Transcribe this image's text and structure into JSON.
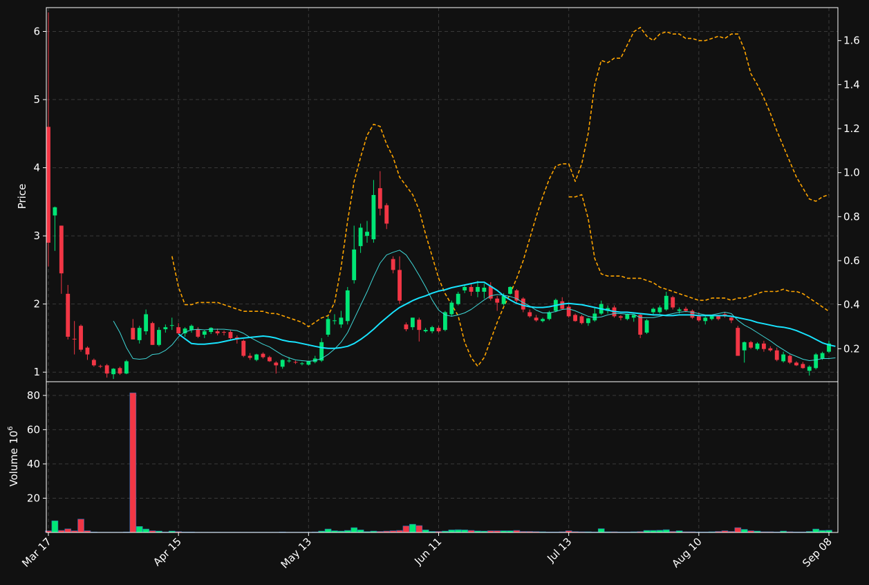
{
  "theme": {
    "background": "#111111",
    "grid": "#3a3a3a",
    "axis": "#ffffff",
    "up_color": "#00e676",
    "down_color": "#f23645",
    "ma_slow_color": "#18e4ff",
    "ma_fast_color": "#3fd8d8",
    "secondary_color": "#ffa500"
  },
  "chart_data": [
    {
      "type": "candlestick",
      "ylabel": "Price",
      "ylim": [
        0.86,
        6.35
      ],
      "yticks": [
        1,
        2,
        3,
        4,
        5,
        6
      ],
      "y2lim": [
        0.05,
        1.75
      ],
      "y2ticks": [
        0.2,
        0.4,
        0.6,
        0.8,
        1.0,
        1.2,
        1.4,
        1.6
      ],
      "grid": true,
      "x_tick_labels": [
        {
          "index": 0,
          "label": "Mar 17"
        },
        {
          "index": 20,
          "label": "Apr 15"
        },
        {
          "index": 40,
          "label": "May 13"
        },
        {
          "index": 60,
          "label": "Jun 11"
        },
        {
          "index": 80,
          "label": "Jul 13"
        },
        {
          "index": 100,
          "label": "Aug 10"
        },
        {
          "index": 120,
          "label": "Sep 08"
        }
      ],
      "ohlc": [
        [
          4.6,
          6.28,
          2.55,
          2.9
        ],
        [
          3.3,
          3.43,
          2.78,
          3.42
        ],
        [
          3.15,
          3.15,
          2.15,
          2.45
        ],
        [
          2.15,
          2.28,
          1.48,
          1.52
        ],
        [
          1.49,
          1.75,
          1.26,
          1.48
        ],
        [
          1.68,
          1.7,
          1.3,
          1.33
        ],
        [
          1.36,
          1.38,
          1.18,
          1.26
        ],
        [
          1.18,
          1.2,
          1.08,
          1.1
        ],
        [
          1.09,
          1.11,
          1.06,
          1.08
        ],
        [
          1.1,
          1.12,
          0.92,
          0.98
        ],
        [
          0.97,
          1.06,
          0.9,
          1.05
        ],
        [
          1.06,
          1.08,
          0.96,
          0.98
        ],
        [
          0.98,
          1.18,
          0.97,
          1.16
        ],
        [
          1.65,
          1.78,
          1.48,
          1.48
        ],
        [
          1.47,
          1.68,
          1.42,
          1.65
        ],
        [
          1.6,
          1.92,
          1.55,
          1.85
        ],
        [
          1.72,
          1.74,
          1.4,
          1.4
        ],
        [
          1.4,
          1.66,
          1.38,
          1.62
        ],
        [
          1.63,
          1.7,
          1.58,
          1.66
        ],
        [
          1.68,
          1.8,
          1.62,
          1.69
        ],
        [
          1.66,
          1.72,
          1.55,
          1.57
        ],
        [
          1.57,
          1.66,
          1.52,
          1.64
        ],
        [
          1.62,
          1.7,
          1.58,
          1.68
        ],
        [
          1.63,
          1.66,
          1.5,
          1.52
        ],
        [
          1.55,
          1.62,
          1.5,
          1.6
        ],
        [
          1.59,
          1.66,
          1.56,
          1.65
        ],
        [
          1.6,
          1.64,
          1.54,
          1.57
        ],
        [
          1.59,
          1.61,
          1.54,
          1.58
        ],
        [
          1.59,
          1.62,
          1.48,
          1.5
        ],
        [
          1.51,
          1.54,
          1.42,
          1.48
        ],
        [
          1.46,
          1.48,
          1.22,
          1.24
        ],
        [
          1.24,
          1.28,
          1.18,
          1.21
        ],
        [
          1.18,
          1.27,
          1.16,
          1.26
        ],
        [
          1.27,
          1.29,
          1.2,
          1.22
        ],
        [
          1.22,
          1.24,
          1.15,
          1.16
        ],
        [
          1.14,
          1.16,
          0.98,
          1.1
        ],
        [
          1.08,
          1.19,
          1.05,
          1.18
        ],
        [
          1.16,
          1.22,
          1.14,
          1.17
        ],
        [
          1.15,
          1.17,
          1.12,
          1.14
        ],
        [
          1.13,
          1.15,
          1.1,
          1.13
        ],
        [
          1.11,
          1.17,
          1.1,
          1.16
        ],
        [
          1.15,
          1.24,
          1.13,
          1.2
        ],
        [
          1.17,
          1.5,
          1.15,
          1.44
        ],
        [
          1.55,
          1.82,
          1.52,
          1.78
        ],
        [
          1.75,
          1.85,
          1.7,
          1.76
        ],
        [
          1.7,
          1.9,
          1.65,
          1.8
        ],
        [
          1.75,
          2.25,
          1.7,
          2.2
        ],
        [
          2.35,
          3.15,
          2.3,
          2.8
        ],
        [
          2.85,
          3.18,
          2.75,
          3.12
        ],
        [
          3.0,
          3.22,
          2.9,
          3.06
        ],
        [
          2.95,
          3.82,
          2.9,
          3.6
        ],
        [
          3.7,
          3.95,
          3.3,
          3.4
        ],
        [
          3.45,
          3.48,
          3.1,
          3.18
        ],
        [
          2.66,
          2.7,
          2.45,
          2.5
        ],
        [
          2.5,
          2.7,
          2.0,
          2.05
        ],
        [
          1.7,
          1.73,
          1.6,
          1.63
        ],
        [
          1.66,
          1.8,
          1.62,
          1.8
        ],
        [
          1.77,
          1.8,
          1.45,
          1.62
        ],
        [
          1.6,
          1.65,
          1.58,
          1.62
        ],
        [
          1.6,
          1.68,
          1.57,
          1.66
        ],
        [
          1.65,
          1.68,
          1.58,
          1.6
        ],
        [
          1.62,
          1.9,
          1.6,
          1.88
        ],
        [
          1.85,
          2.05,
          1.82,
          2.02
        ],
        [
          2.0,
          2.18,
          1.98,
          2.15
        ],
        [
          2.2,
          2.28,
          2.16,
          2.25
        ],
        [
          2.25,
          2.3,
          2.12,
          2.18
        ],
        [
          2.18,
          2.34,
          2.1,
          2.25
        ],
        [
          2.18,
          2.3,
          2.08,
          2.24
        ],
        [
          2.26,
          2.32,
          2.05,
          2.08
        ],
        [
          2.08,
          2.12,
          1.9,
          2.02
        ],
        [
          2.0,
          2.16,
          1.98,
          2.12
        ],
        [
          2.15,
          2.26,
          2.14,
          2.25
        ],
        [
          2.2,
          2.22,
          2.02,
          2.05
        ],
        [
          2.08,
          2.1,
          1.88,
          1.92
        ],
        [
          1.88,
          1.92,
          1.8,
          1.82
        ],
        [
          1.8,
          1.84,
          1.74,
          1.76
        ],
        [
          1.75,
          1.8,
          1.73,
          1.78
        ],
        [
          1.78,
          1.9,
          1.76,
          1.88
        ],
        [
          1.9,
          2.08,
          1.88,
          2.06
        ],
        [
          2.04,
          2.1,
          1.92,
          1.93
        ],
        [
          1.96,
          2.0,
          1.8,
          1.82
        ],
        [
          1.84,
          1.86,
          1.74,
          1.75
        ],
        [
          1.82,
          1.84,
          1.7,
          1.72
        ],
        [
          1.72,
          1.8,
          1.68,
          1.79
        ],
        [
          1.76,
          1.96,
          1.74,
          1.86
        ],
        [
          1.86,
          2.05,
          1.84,
          2.0
        ],
        [
          1.9,
          1.98,
          1.86,
          1.94
        ],
        [
          1.95,
          1.98,
          1.8,
          1.82
        ],
        [
          1.82,
          1.84,
          1.76,
          1.8
        ],
        [
          1.78,
          1.86,
          1.76,
          1.85
        ],
        [
          1.8,
          1.82,
          1.74,
          1.84
        ],
        [
          1.84,
          1.86,
          1.5,
          1.55
        ],
        [
          1.58,
          1.78,
          1.56,
          1.76
        ],
        [
          1.88,
          1.95,
          1.85,
          1.93
        ],
        [
          1.88,
          1.98,
          1.86,
          1.95
        ],
        [
          1.92,
          2.18,
          1.9,
          2.12
        ],
        [
          2.1,
          2.12,
          1.92,
          1.95
        ],
        [
          1.9,
          1.95,
          1.86,
          1.92
        ],
        [
          1.93,
          1.96,
          1.88,
          1.9
        ],
        [
          1.9,
          1.92,
          1.78,
          1.8
        ],
        [
          1.82,
          1.88,
          1.74,
          1.76
        ],
        [
          1.75,
          1.82,
          1.7,
          1.8
        ],
        [
          1.78,
          1.84,
          1.76,
          1.82
        ],
        [
          1.82,
          1.84,
          1.76,
          1.78
        ],
        [
          1.85,
          1.88,
          1.8,
          1.82
        ],
        [
          1.8,
          1.82,
          1.72,
          1.76
        ],
        [
          1.65,
          1.68,
          1.24,
          1.24
        ],
        [
          1.32,
          1.45,
          1.14,
          1.44
        ],
        [
          1.44,
          1.46,
          1.34,
          1.36
        ],
        [
          1.34,
          1.44,
          1.32,
          1.42
        ],
        [
          1.42,
          1.46,
          1.3,
          1.34
        ],
        [
          1.35,
          1.38,
          1.3,
          1.32
        ],
        [
          1.32,
          1.36,
          1.16,
          1.18
        ],
        [
          1.16,
          1.3,
          1.14,
          1.26
        ],
        [
          1.24,
          1.26,
          1.12,
          1.14
        ],
        [
          1.14,
          1.16,
          1.09,
          1.1
        ],
        [
          1.12,
          1.15,
          1.05,
          1.06
        ],
        [
          1.02,
          1.1,
          0.95,
          1.08
        ],
        [
          1.06,
          1.28,
          1.04,
          1.26
        ],
        [
          1.2,
          1.3,
          1.18,
          1.28
        ],
        [
          1.3,
          1.46,
          1.28,
          1.42
        ]
      ],
      "ma_slow": [
        null,
        null,
        null,
        null,
        null,
        null,
        null,
        null,
        null,
        null,
        null,
        null,
        null,
        null,
        null,
        null,
        null,
        null,
        null,
        null,
        1.56,
        1.49,
        1.42,
        1.41,
        1.41,
        1.42,
        1.43,
        1.45,
        1.47,
        1.49,
        1.5,
        1.51,
        1.52,
        1.53,
        1.52,
        1.5,
        1.47,
        1.45,
        1.44,
        1.42,
        1.4,
        1.38,
        1.36,
        1.35,
        1.35,
        1.36,
        1.38,
        1.42,
        1.48,
        1.55,
        1.63,
        1.72,
        1.8,
        1.88,
        1.95,
        2.0,
        2.05,
        2.09,
        2.12,
        2.16,
        2.19,
        2.21,
        2.24,
        2.26,
        2.28,
        2.3,
        2.32,
        2.32,
        2.26,
        2.2,
        2.12,
        2.06,
        2.01,
        1.98,
        1.96,
        1.95,
        1.95,
        1.96,
        1.98,
        2.0,
        2.01,
        2.0,
        1.99,
        1.97,
        1.95,
        1.93,
        1.91,
        1.89,
        1.88,
        1.88,
        1.87,
        1.86,
        1.85,
        1.84,
        1.84,
        1.83,
        1.83,
        1.84,
        1.84,
        1.84,
        1.83,
        1.83,
        1.83,
        1.83,
        1.83,
        1.82,
        1.8,
        1.78,
        1.76,
        1.73,
        1.71,
        1.69,
        1.67,
        1.66,
        1.64,
        1.61,
        1.57,
        1.53,
        1.48,
        1.43,
        1.4,
        1.38
      ],
      "ma_fast": [
        null,
        null,
        null,
        null,
        null,
        null,
        null,
        null,
        null,
        null,
        1.75,
        1.58,
        1.36,
        1.2,
        1.19,
        1.2,
        1.26,
        1.27,
        1.32,
        1.4,
        1.52,
        1.59,
        1.62,
        1.63,
        1.62,
        1.63,
        1.63,
        1.63,
        1.62,
        1.61,
        1.57,
        1.51,
        1.46,
        1.41,
        1.37,
        1.31,
        1.25,
        1.21,
        1.18,
        1.17,
        1.16,
        1.17,
        1.2,
        1.26,
        1.34,
        1.44,
        1.58,
        1.78,
        1.98,
        2.18,
        2.4,
        2.6,
        2.72,
        2.76,
        2.79,
        2.72,
        2.58,
        2.42,
        2.25,
        2.06,
        1.91,
        1.84,
        1.82,
        1.84,
        1.87,
        1.92,
        1.99,
        2.06,
        2.12,
        2.14,
        2.13,
        2.11,
        2.08,
        2.02,
        1.97,
        1.91,
        1.87,
        1.87,
        1.89,
        1.92,
        1.93,
        1.9,
        1.86,
        1.82,
        1.8,
        1.81,
        1.84,
        1.86,
        1.86,
        1.85,
        1.85,
        1.8,
        1.8,
        1.8,
        1.82,
        1.84,
        1.86,
        1.88,
        1.89,
        1.88,
        1.86,
        1.84,
        1.84,
        1.86,
        1.88,
        1.86,
        1.76,
        1.69,
        1.64,
        1.58,
        1.52,
        1.46,
        1.39,
        1.33,
        1.27,
        1.23,
        1.19,
        1.17,
        1.18,
        1.2,
        1.2,
        1.21
      ],
      "secondary_line": {
        "axis": "right",
        "style": "dashed",
        "values": [
          null,
          null,
          null,
          null,
          null,
          null,
          null,
          null,
          null,
          null,
          null,
          null,
          null,
          null,
          null,
          null,
          null,
          null,
          null,
          0.62,
          0.48,
          0.4,
          0.4,
          0.41,
          0.41,
          0.41,
          0.41,
          0.4,
          0.39,
          0.38,
          0.37,
          0.37,
          0.37,
          0.37,
          0.36,
          0.36,
          0.35,
          0.34,
          0.33,
          0.32,
          0.3,
          0.32,
          0.34,
          0.35,
          0.41,
          0.57,
          0.78,
          0.96,
          1.07,
          1.17,
          1.22,
          1.21,
          1.13,
          1.07,
          0.98,
          0.94,
          0.9,
          0.83,
          0.72,
          0.62,
          0.52,
          0.45,
          0.4,
          0.35,
          0.23,
          0.16,
          0.12,
          0.16,
          0.24,
          0.32,
          0.39,
          0.45,
          0.52,
          0.6,
          0.7,
          0.8,
          0.89,
          0.97,
          1.03,
          1.04,
          1.04,
          0.96,
          1.04,
          1.18,
          1.4,
          1.51,
          1.5,
          1.52,
          1.52,
          1.58,
          1.64,
          1.66,
          1.62,
          1.6,
          1.63,
          1.64,
          1.63,
          1.63,
          1.61,
          1.61,
          1.6,
          1.6,
          1.61,
          1.62,
          1.61,
          1.63,
          1.63,
          1.56,
          1.45,
          1.4,
          1.34,
          1.27,
          1.19,
          1.12,
          1.05,
          0.98,
          0.93,
          0.88,
          0.87,
          0.89,
          0.9
        ]
      },
      "secondary_line_tail": [
        0.89,
        0.89,
        0.9,
        0.79,
        0.61,
        0.54,
        0.53,
        0.53,
        0.53,
        0.52,
        0.52,
        0.52,
        0.51,
        0.5,
        0.48,
        0.47,
        0.46,
        0.45,
        0.44,
        0.43,
        0.42,
        0.42,
        0.43,
        0.43,
        0.43,
        0.42,
        0.43,
        0.43,
        0.44,
        0.45,
        0.46,
        0.46,
        0.46,
        0.47,
        0.46,
        0.46,
        0.45,
        0.43,
        0.41,
        0.39,
        0.37
      ]
    },
    {
      "type": "bar",
      "ylabel": "Volume  10^6",
      "ylabel_text": "Volume",
      "ylabel_exponent": "10",
      "ylabel_power": "6",
      "ylim": [
        0,
        88
      ],
      "yticks": [
        20,
        40,
        60,
        80
      ],
      "grid": true,
      "values": [
        1.0,
        6.8,
        1.2,
        2.1,
        1.0,
        7.8,
        1.0,
        0.3,
        0.2,
        0.2,
        0.2,
        0.2,
        0.3,
        81.5,
        3.5,
        2.0,
        1.0,
        0.8,
        0.3,
        0.8,
        0.5,
        0.3,
        0.3,
        0.2,
        0.2,
        0.2,
        0.2,
        0.2,
        0.2,
        0.2,
        0.2,
        0.2,
        0.2,
        0.2,
        0.2,
        0.2,
        0.3,
        0.2,
        0.2,
        0.2,
        0.2,
        0.3,
        0.8,
        2.0,
        1.0,
        0.8,
        1.2,
        2.8,
        1.5,
        0.5,
        0.8,
        0.6,
        0.8,
        1.0,
        1.2,
        3.8,
        4.8,
        4.0,
        1.5,
        0.6,
        0.6,
        0.8,
        1.5,
        1.6,
        1.5,
        1.2,
        0.9,
        0.8,
        1.0,
        1.0,
        1.0,
        1.0,
        1.2,
        0.6,
        0.6,
        0.5,
        0.4,
        0.3,
        0.3,
        0.4,
        1.0,
        0.5,
        0.4,
        0.4,
        0.3,
        2.2,
        0.4,
        0.4,
        0.3,
        0.3,
        0.4,
        0.5,
        1.2,
        1.2,
        1.3,
        1.6,
        0.6,
        1.0,
        0.4,
        0.4,
        0.3,
        0.3,
        0.4,
        0.6,
        1.0,
        0.6,
        2.8,
        1.8,
        1.0,
        0.8,
        0.4,
        0.4,
        0.3,
        0.8,
        0.4,
        0.3,
        0.3,
        0.6,
        2.0,
        1.2,
        1.3
      ]
    }
  ]
}
